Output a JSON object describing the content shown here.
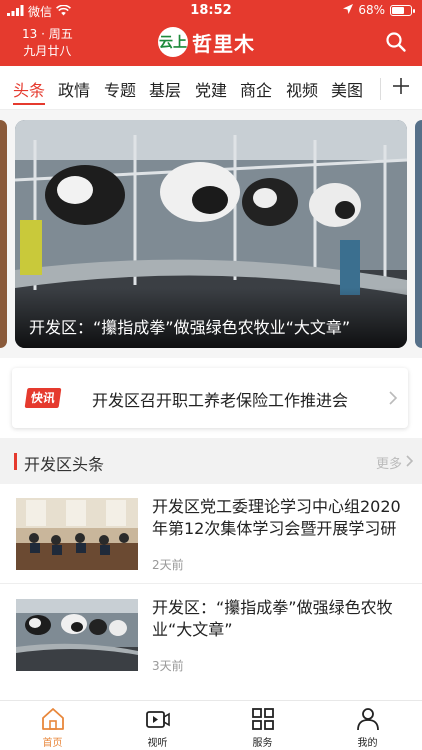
{
  "status_bar": {
    "carrier": "微信",
    "time": "18:52",
    "battery": "68%",
    "battery_level": 0.68
  },
  "header": {
    "date_line1": "13 · 周五",
    "date_line2": "九月廿八",
    "logo_badge": "云上",
    "logo_text": "哲里木",
    "search_icon": "search-icon"
  },
  "tabs": [
    {
      "label": "头条",
      "active": true
    },
    {
      "label": "政情"
    },
    {
      "label": "专题"
    },
    {
      "label": "基层"
    },
    {
      "label": "党建"
    },
    {
      "label": "商企"
    },
    {
      "label": "视频"
    },
    {
      "label": "美图"
    }
  ],
  "carousel": {
    "caption": "开发区：“攥指成拳”做强绿色农牧业“大文章”"
  },
  "flash": {
    "tag": "快讯",
    "text": "开发区召开职工养老保险工作推进会"
  },
  "section": {
    "title": "开发区头条",
    "more": "更多"
  },
  "news": [
    {
      "title": "开发区党工委理论学习中心组2020年第12次集体学习会暨开展学习研讨",
      "time": "2天前"
    },
    {
      "title": "开发区：“攥指成拳”做强绿色农牧业“大文章”",
      "time": "3天前"
    }
  ],
  "bottom_nav": [
    {
      "label": "首页",
      "icon": "home-icon",
      "active": true
    },
    {
      "label": "视听",
      "icon": "video-icon"
    },
    {
      "label": "服务",
      "icon": "grid-icon"
    },
    {
      "label": "我的",
      "icon": "person-icon"
    }
  ],
  "colors": {
    "brand_red": "#e53a2e",
    "active_nav": "#e8873b"
  }
}
